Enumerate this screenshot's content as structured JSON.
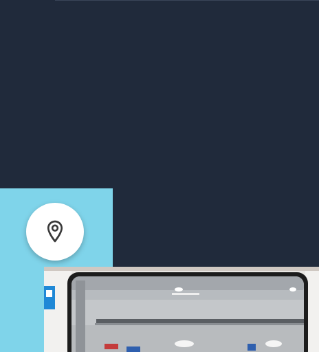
{
  "screen": {
    "background_color": "#202a3b",
    "accent_color": "#7fd4ea"
  },
  "location_button": {
    "icon": "map-pin-icon",
    "color": "#ffffff",
    "icon_color": "#3a3a3a"
  },
  "photo": {
    "subject": "subway-train-door-window",
    "interior_color": "#e9e7e4"
  }
}
